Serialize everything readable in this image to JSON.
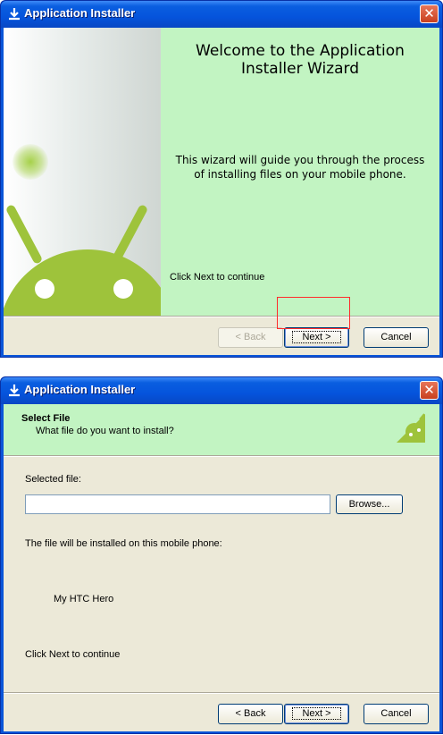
{
  "window_title": "Application Installer",
  "title_icon": "download-icon",
  "close_glyph": "✕",
  "welcome": {
    "title": "Welcome to the Application\nInstaller Wizard",
    "description": "This wizard will guide you through the process\nof installing files on your mobile phone.",
    "continue_text": "Click Next to continue",
    "illustration": "android-robot"
  },
  "select_file": {
    "header_title": "Select File",
    "header_subtitle": "What file do you want to install?",
    "selected_file_label": "Selected file:",
    "selected_file_value": "",
    "browse_label": "Browse...",
    "install_target_label": "The file will be installed on this mobile phone:",
    "device_name": "My HTC Hero",
    "continue_text": "Click Next to continue"
  },
  "buttons": {
    "back": "< Back",
    "next": "Next >",
    "cancel": "Cancel"
  },
  "colors": {
    "titlebar": "#0a5ee0",
    "panel_green": "#c2f4c2",
    "android_green": "#9ec33b",
    "highlight_red": "#ff2b2b"
  }
}
